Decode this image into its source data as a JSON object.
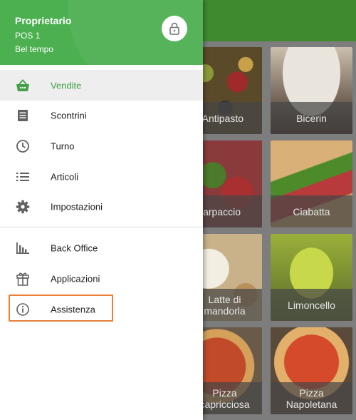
{
  "header": {
    "owner": "Proprietario",
    "pos": "POS 1",
    "store": "Bel tempo",
    "lock_icon": "lock-icon"
  },
  "menu": [
    {
      "label": "Vendite",
      "icon": "basket-icon",
      "active": true
    },
    {
      "label": "Scontrini",
      "icon": "receipt-icon"
    },
    {
      "label": "Turno",
      "icon": "clock-icon"
    },
    {
      "label": "Articoli",
      "icon": "list-icon"
    },
    {
      "label": "Impostazioni",
      "icon": "gear-icon"
    },
    {
      "label": "Back Office",
      "icon": "bar-chart-icon"
    },
    {
      "label": "Applicazioni",
      "icon": "gift-icon"
    },
    {
      "label": "Assistenza",
      "icon": "info-icon",
      "highlighted": true
    }
  ],
  "items": [
    {
      "name": "Antipasto"
    },
    {
      "name": "Bicerin"
    },
    {
      "name": "Carpaccio"
    },
    {
      "name": "Ciabatta"
    },
    {
      "line1": "Latte di",
      "line2": "mandorla"
    },
    {
      "name": "Limoncello"
    },
    {
      "line1": "Pizza",
      "line2": "capricciosa"
    },
    {
      "line1": "Pizza",
      "line2": "Napoletana"
    }
  ],
  "colors": {
    "brand_green": "#4caf50",
    "appbar_green": "#3f8a2f",
    "active_text": "#43a047",
    "highlight_border": "#e8803a"
  }
}
